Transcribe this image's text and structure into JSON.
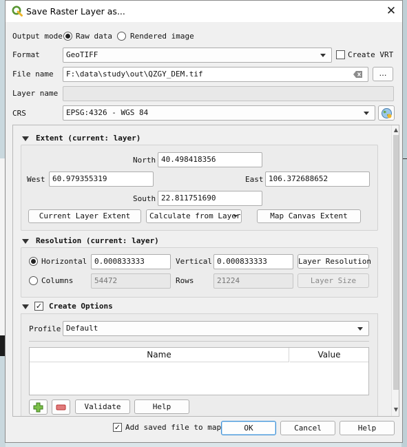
{
  "window": {
    "title": "Save Raster Layer as...",
    "close_glyph": "✕",
    "icon": "qgis-icon"
  },
  "output_mode": {
    "label": "Output mode",
    "options": [
      "Raw data",
      "Rendered image"
    ],
    "selected": "Raw data"
  },
  "format": {
    "label": "Format",
    "value": "GeoTIFF",
    "create_vrt_label": "Create VRT",
    "create_vrt_checked": false
  },
  "file_name": {
    "label": "File name",
    "value": "F:\\data\\study\\out\\QZGY_DEM.tif",
    "browse_label": "…"
  },
  "layer_name": {
    "label": "Layer name",
    "value": ""
  },
  "crs": {
    "label": "CRS",
    "value": "EPSG:4326 - WGS 84",
    "icon": "globe-icon"
  },
  "extent": {
    "title": "Extent (current: layer)",
    "north_label": "North",
    "north": "40.498418356",
    "west_label": "West",
    "west": "60.979355319",
    "east_label": "East",
    "east": "106.372688652",
    "south_label": "South",
    "south": "22.811751690",
    "btn_current": "Current Layer Extent",
    "btn_calc": "Calculate from Layer",
    "btn_canvas": "Map Canvas Extent"
  },
  "resolution": {
    "title": "Resolution (current: layer)",
    "horizontal_label": "Horizontal",
    "horizontal": "0.000833333",
    "vertical_label": "Vertical",
    "vertical": "0.000833333",
    "btn_layer_res": "Layer Resolution",
    "columns_label": "Columns",
    "columns": "54472",
    "rows_label": "Rows",
    "rows": "21224",
    "btn_layer_size": "Layer Size",
    "selected": "Horizontal"
  },
  "create_options": {
    "title": "Create Options",
    "checked": true,
    "profile_label": "Profile",
    "profile": "Default",
    "columns": [
      "Name",
      "Value"
    ],
    "btn_add": "+",
    "btn_remove": "−",
    "btn_validate": "Validate",
    "btn_help": "Help"
  },
  "footer": {
    "add_to_map_label": "Add saved file to map",
    "add_to_map_checked": true,
    "ok": "OK",
    "cancel": "Cancel",
    "help": "Help"
  },
  "colors": {
    "accent": "#3c8fd6",
    "qgis_green": "#589632",
    "qgis_yellow": "#eeb52a",
    "remove_red": "#d64b4b"
  }
}
